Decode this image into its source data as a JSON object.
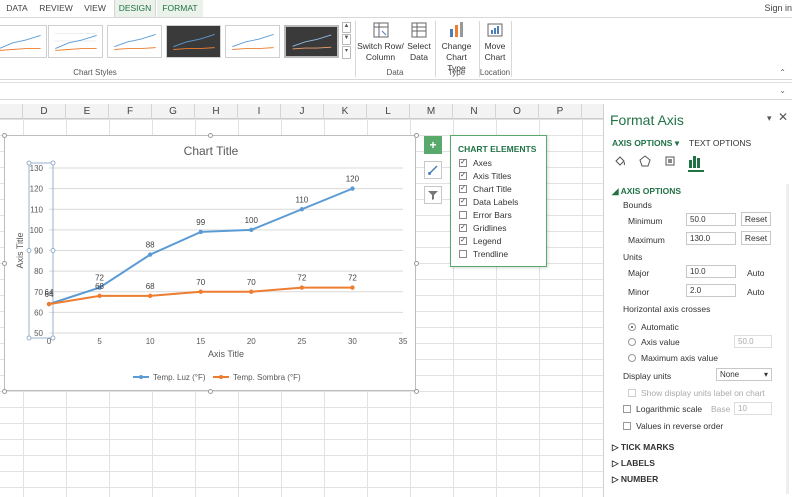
{
  "ribbon": {
    "tabs": [
      "DATA",
      "REVIEW",
      "VIEW",
      "DESIGN",
      "FORMAT"
    ],
    "signin": "Sign in",
    "chart_styles_label": "Chart Styles",
    "data_group_label": "Data",
    "type_group_label": "Type",
    "location_group_label": "Location",
    "switch_row_col_line1": "Switch Row/",
    "switch_row_col_line2": "Column",
    "select_data_line1": "Select",
    "select_data_line2": "Data",
    "change_chart_type_line1": "Change",
    "change_chart_type_line2": "Chart Type",
    "move_chart_line1": "Move",
    "move_chart_line2": "Chart"
  },
  "columns": [
    "D",
    "E",
    "F",
    "G",
    "H",
    "I",
    "J",
    "K",
    "L",
    "M",
    "N",
    "O",
    "P"
  ],
  "chart_data": {
    "type": "line",
    "title": "Chart Title",
    "xlabel": "Axis Title",
    "ylabel": "Axis Title",
    "xlim": [
      0,
      35
    ],
    "ylim": [
      50,
      130
    ],
    "xticks": [
      "0",
      "5",
      "10",
      "15",
      "20",
      "25",
      "30",
      "35"
    ],
    "yticks": [
      "50",
      "60",
      "70",
      "80",
      "90",
      "100",
      "110",
      "120",
      "130"
    ],
    "x": [
      0,
      5,
      10,
      15,
      20,
      25,
      30
    ],
    "series": [
      {
        "name": "Temp. Luz (°F)",
        "values": [
          64,
          72,
          88,
          99,
          100,
          110,
          120
        ],
        "color": "#5b9bd5",
        "labels": [
          "64",
          "72",
          "88",
          "99",
          "100",
          "110",
          "120"
        ]
      },
      {
        "name": "Temp. Sombra (°F)",
        "values": [
          64,
          68,
          68,
          70,
          70,
          72,
          72
        ],
        "color": "#ed7d31",
        "labels": [
          "64",
          "68",
          "68",
          "70",
          "70",
          "72",
          "72"
        ]
      }
    ],
    "grid": true,
    "legend": "bottom"
  },
  "chart_elements": {
    "title": "CHART ELEMENTS",
    "items": [
      {
        "label": "Axes",
        "checked": "✓"
      },
      {
        "label": "Axis Titles",
        "checked": "✓"
      },
      {
        "label": "Chart Title",
        "checked": "✓"
      },
      {
        "label": "Data Labels",
        "checked": "✓"
      },
      {
        "label": "Error Bars",
        "checked": ""
      },
      {
        "label": "Gridlines",
        "checked": "✓"
      },
      {
        "label": "Legend",
        "checked": "✓"
      },
      {
        "label": "Trendline",
        "checked": ""
      }
    ]
  },
  "pane": {
    "title": "Format Axis",
    "tab_axis_options": "AXIS OPTIONS",
    "tab_text_options": "TEXT OPTIONS",
    "section_axis_options": "AXIS OPTIONS",
    "bounds": "Bounds",
    "minimum_label": "Minimum",
    "minimum_value": "50.0",
    "maximum_label": "Maximum",
    "maximum_value": "130.0",
    "reset": "Reset",
    "units": "Units",
    "major_label": "Major",
    "major_value": "10.0",
    "minor_label": "Minor",
    "minor_value": "2.0",
    "auto": "Auto",
    "hac_label": "Horizontal axis crosses",
    "radio_automatic": "Automatic",
    "radio_axis_value": "Axis value",
    "axis_value_input": "50.0",
    "radio_max_axis_value": "Maximum axis value",
    "display_units_label": "Display units",
    "display_units_value": "None",
    "show_display_units": "Show display units label on chart",
    "log_scale": "Logarithmic scale",
    "base_label": "Base",
    "base_value": "10",
    "reverse_order": "Values in reverse order",
    "tick_marks": "TICK MARKS",
    "labels": "LABELS",
    "number": "NUMBER"
  }
}
